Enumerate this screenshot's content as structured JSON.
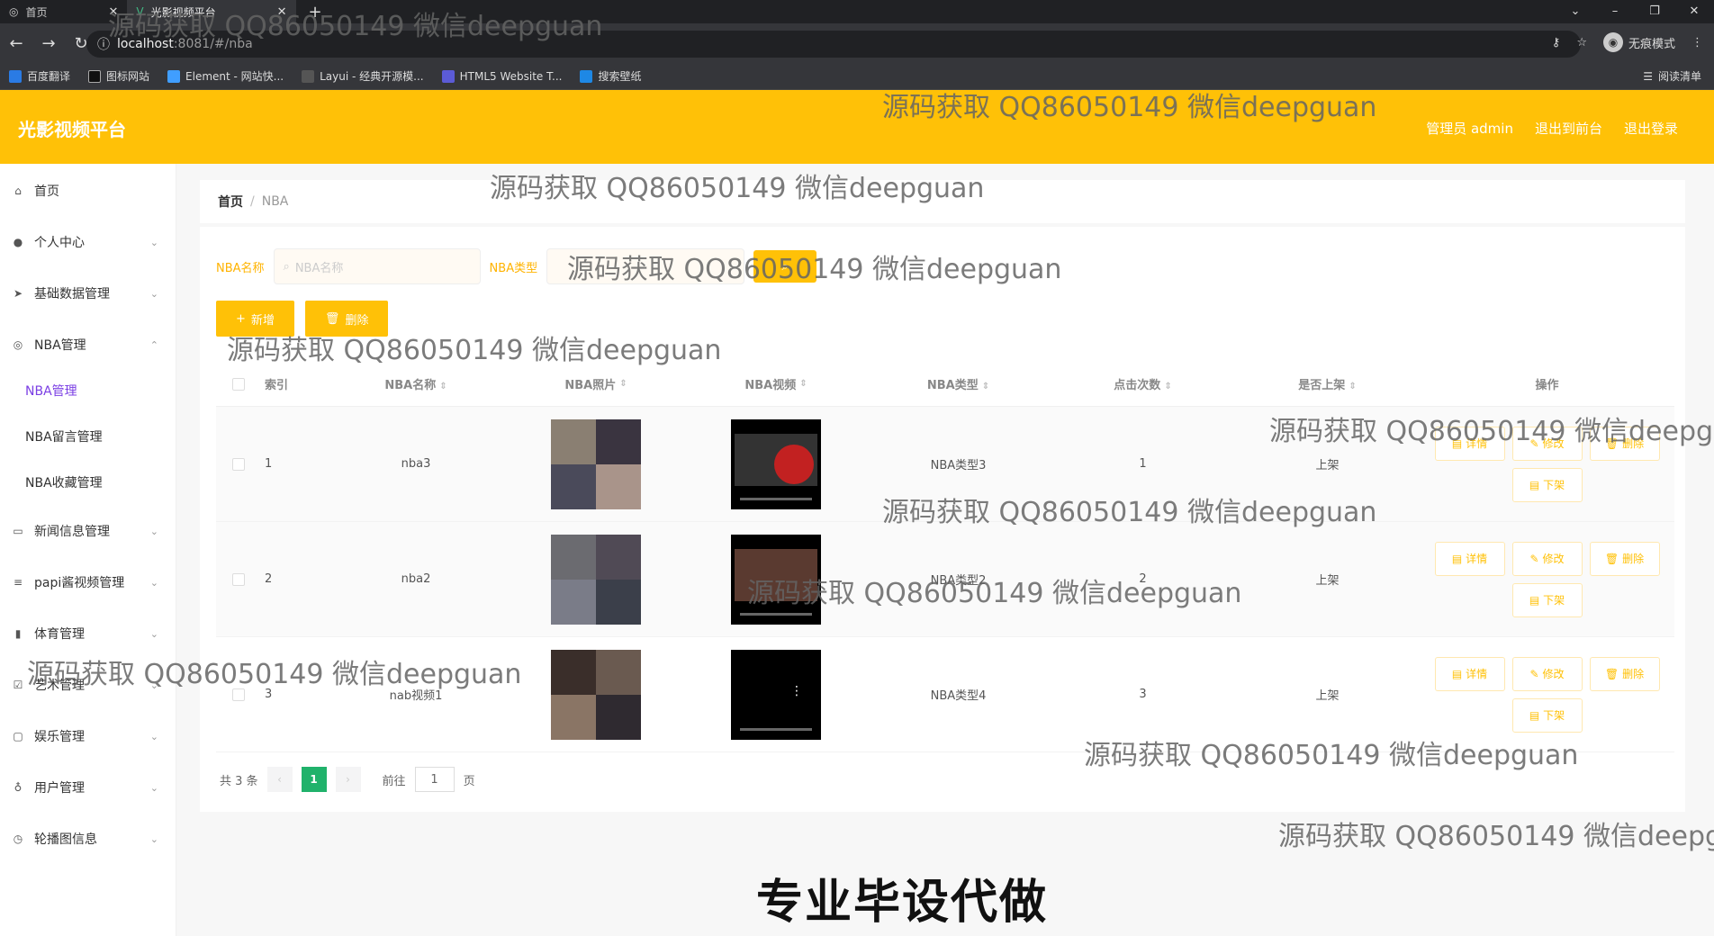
{
  "browser": {
    "tabs": [
      {
        "label": "首页"
      },
      {
        "label": "光影视频平台"
      }
    ],
    "url_host": "localhost",
    "url_path": ":8081/#/nba",
    "profile_label": "无痕模式",
    "bookmarks": [
      "百度翻译",
      "图标网站",
      "Element - 网站快...",
      "Layui - 经典开源模...",
      "HTML5 Website T...",
      "搜索壁纸"
    ],
    "reading_list": "阅读清单"
  },
  "app": {
    "title": "光影视频平台",
    "admin_label": "管理员 admin",
    "back_front": "退出到前台",
    "logout": "退出登录"
  },
  "sidebar": {
    "items": [
      {
        "label": "首页",
        "icon": "home-icon"
      },
      {
        "label": "个人中心",
        "icon": "user-icon"
      },
      {
        "label": "基础数据管理",
        "icon": "send-icon"
      },
      {
        "label": "NBA管理",
        "icon": "globe-icon"
      },
      {
        "label": "新闻信息管理",
        "icon": "news-icon"
      },
      {
        "label": "papi酱视频管理",
        "icon": "menu-icon"
      },
      {
        "label": "体育管理",
        "icon": "chart-icon"
      },
      {
        "label": "艺术管理",
        "icon": "check-icon"
      },
      {
        "label": "娱乐管理",
        "icon": "message-icon"
      },
      {
        "label": "用户管理",
        "icon": "mic-icon"
      },
      {
        "label": "轮播图信息",
        "icon": "clock-icon"
      }
    ],
    "sub_items": [
      {
        "label": "NBA管理",
        "active": true
      },
      {
        "label": "NBA留言管理",
        "active": false
      },
      {
        "label": "NBA收藏管理",
        "active": false
      }
    ]
  },
  "breadcrumb": {
    "home": "首页",
    "sep": "/",
    "current": "NBA"
  },
  "filter": {
    "name_label": "NBA名称",
    "name_placeholder": "NBA名称",
    "type_label": "NBA类型"
  },
  "actions": {
    "add": "新增",
    "delete": "删除"
  },
  "table": {
    "headers": {
      "index": "索引",
      "name": "NBA名称",
      "photo": "NBA照片",
      "video": "NBA视频",
      "type": "NBA类型",
      "clicks": "点击次数",
      "shelf": "是否上架",
      "ops": "操作"
    },
    "rows": [
      {
        "index": "1",
        "name": "nba3",
        "type": "NBA类型3",
        "clicks": "1",
        "shelf": "上架"
      },
      {
        "index": "2",
        "name": "nba2",
        "type": "NBA类型2",
        "clicks": "2",
        "shelf": "上架"
      },
      {
        "index": "3",
        "name": "nab视频1",
        "type": "NBA类型4",
        "clicks": "3",
        "shelf": "上架"
      }
    ],
    "op_labels": {
      "detail": "详情",
      "edit": "修改",
      "remove": "删除",
      "off": "下架"
    }
  },
  "pager": {
    "total": "共 3 条",
    "current": "1",
    "goto_label": "前往",
    "goto_value": "1",
    "page_unit": "页"
  },
  "watermark": "源码获取 QQ86050149 微信deepguan",
  "caption": "专业毕设代做",
  "colors": {
    "accent": "#ffc107",
    "active_menu": "#7b3fe4",
    "pager_on": "#20b26b"
  }
}
